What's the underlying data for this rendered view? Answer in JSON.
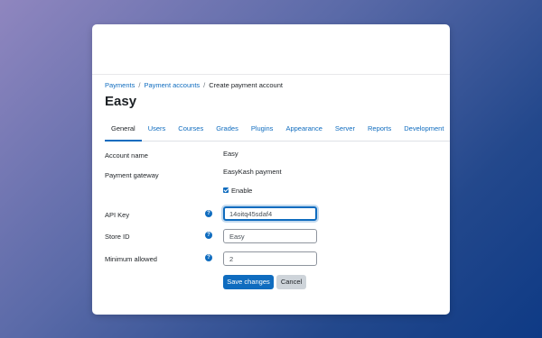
{
  "breadcrumb": [
    "Payments",
    "Payment accounts",
    "Create payment account"
  ],
  "page_title": "Easy",
  "tabs": [
    "General",
    "Users",
    "Courses",
    "Grades",
    "Plugins",
    "Appearance",
    "Server",
    "Reports",
    "Development"
  ],
  "form": {
    "account_name_label": "Account name",
    "account_name_value": "Easy",
    "gateway_label": "Payment gateway",
    "gateway_value": "EasyKash payment",
    "enable_label": "Enable",
    "api_key_label": "API Key",
    "api_key_value": "14oitq45sdaf4",
    "store_id_label": "Store ID",
    "store_id_value": "Easy",
    "min_allowed_label": "Minimum allowed",
    "min_allowed_value": "2",
    "help_glyph": "?"
  },
  "buttons": {
    "save": "Save changes",
    "cancel": "Cancel"
  },
  "colors": {
    "accent": "#0f6cbf",
    "secondary_btn": "#ced4da",
    "text": "#1d2125"
  }
}
